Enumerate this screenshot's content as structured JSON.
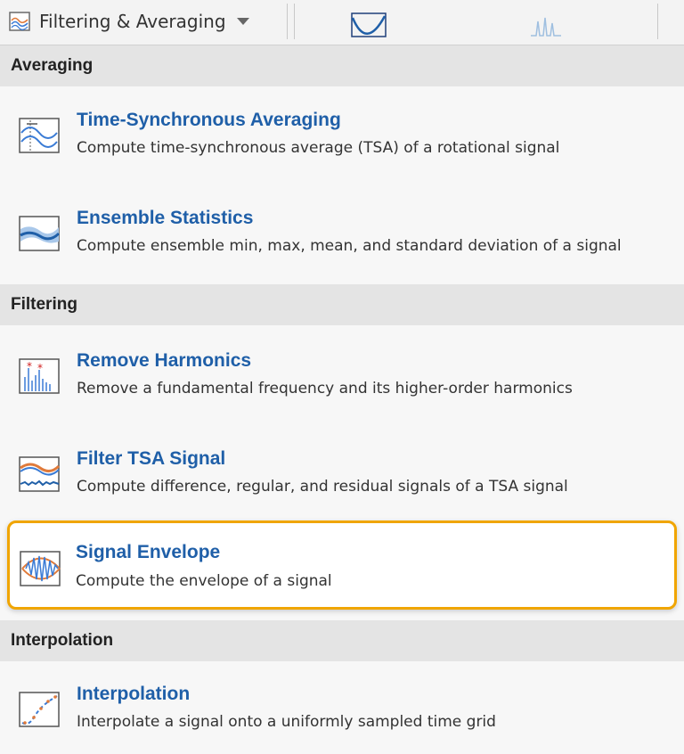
{
  "toolbar": {
    "dropdown_label": "Filtering & Averaging"
  },
  "sections": [
    {
      "header": "Averaging",
      "items": [
        {
          "title": "Time-Synchronous Averaging",
          "desc": "Compute time-synchronous average (TSA) of a rotational signal",
          "icon": "tsa-icon"
        },
        {
          "title": "Ensemble Statistics",
          "desc": "Compute ensemble min, max, mean, and standard deviation of a signal",
          "icon": "ensemble-stats-icon"
        }
      ]
    },
    {
      "header": "Filtering",
      "items": [
        {
          "title": "Remove Harmonics",
          "desc": "Remove a fundamental frequency and its higher-order harmonics",
          "icon": "remove-harmonics-icon"
        },
        {
          "title": "Filter TSA Signal",
          "desc": "Compute difference, regular, and residual signals of a TSA signal",
          "icon": "filter-tsa-icon"
        },
        {
          "title": "Signal Envelope",
          "desc": "Compute the envelope of a signal",
          "icon": "signal-envelope-icon",
          "selected": true
        }
      ]
    },
    {
      "header": "Interpolation",
      "items": [
        {
          "title": "Interpolation",
          "desc": "Interpolate a signal onto a uniformly sampled time grid",
          "icon": "interpolation-icon"
        }
      ]
    }
  ],
  "colors": {
    "title_blue": "#1f5fa8",
    "highlight_border": "#f0a500",
    "section_bg": "#e4e4e4"
  }
}
